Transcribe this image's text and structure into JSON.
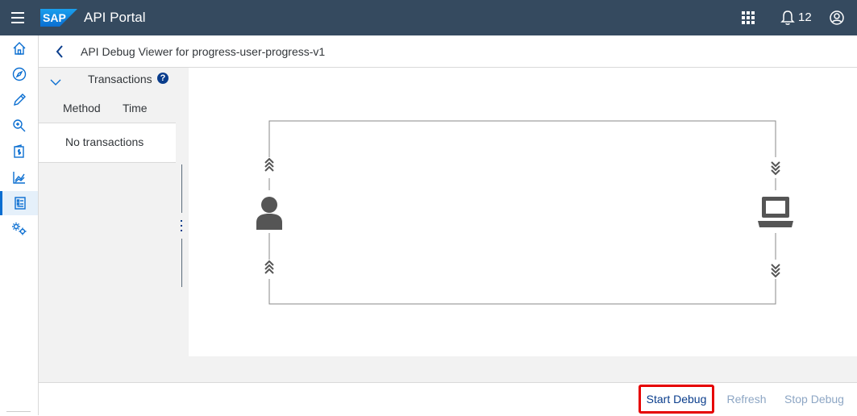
{
  "shellbar": {
    "logo_text": "SAP",
    "app_title": "API Portal",
    "notification_count": "12"
  },
  "sidenav": {
    "items": [
      {
        "icon": "home-icon"
      },
      {
        "icon": "discover-icon"
      },
      {
        "icon": "design-icon"
      },
      {
        "icon": "test-icon"
      },
      {
        "icon": "product-icon"
      },
      {
        "icon": "analyze-icon"
      },
      {
        "icon": "debug-icon",
        "active": true
      },
      {
        "icon": "settings-icon"
      }
    ]
  },
  "page": {
    "title": "API Debug Viewer for progress-user-progress-v1"
  },
  "transactions": {
    "label": "Transactions",
    "help": "?",
    "columns": [
      "Method",
      "Time"
    ],
    "empty_text": "No transactions"
  },
  "footer": {
    "start_label": "Start Debug",
    "refresh_label": "Refresh",
    "stop_label": "Stop Debug"
  },
  "colors": {
    "shellbar": "#354a5f",
    "accent": "#0a6ed1",
    "highlight": "#e60000"
  }
}
